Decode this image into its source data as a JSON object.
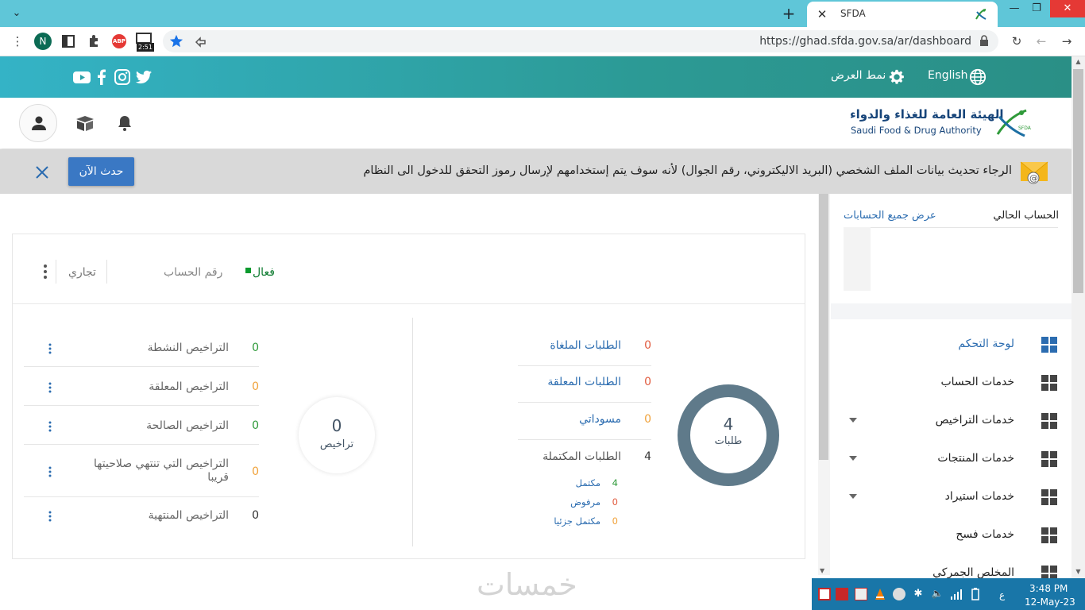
{
  "browser": {
    "tab_title": "SFDA",
    "url": "https://ghad.sfda.gov.sa/ar/dashboard",
    "profile_initial": "N",
    "extension_timer": "2:51",
    "abp_label": "ABP"
  },
  "site_header": {
    "language_label": "English",
    "theme_label": "نمط العرض",
    "social": [
      "youtube-icon",
      "facebook-icon",
      "instagram-icon",
      "twitter-icon"
    ],
    "logo_ar": "الهيئة العامة للغذاء والدواء",
    "logo_en": "Saudi Food & Drug Authority"
  },
  "alert": {
    "message": "الرجاء تحديث بيانات الملف الشخصي (البريد الاليكتروني، رقم الجوال) لأنه سوف يتم إستخدامهم لإرسال رموز التحقق للدخول الى النظام",
    "button_label": "حدث الآن"
  },
  "sidebar": {
    "current_account_label": "الحساب الحالي",
    "view_all_accounts_label": "عرض جميع الحسابات",
    "menu": [
      {
        "label": "لوحة التحكم",
        "active": true,
        "expandable": false
      },
      {
        "label": "خدمات الحساب",
        "active": false,
        "expandable": false
      },
      {
        "label": "خدمات التراخيص",
        "active": false,
        "expandable": true
      },
      {
        "label": "خدمات المنتجات",
        "active": false,
        "expandable": true
      },
      {
        "label": "خدمات استيراد",
        "active": false,
        "expandable": true
      },
      {
        "label": "خدمات فسح",
        "active": false,
        "expandable": false
      },
      {
        "label": "المخلص الجمركي",
        "active": false,
        "expandable": false
      }
    ]
  },
  "account_card": {
    "status_label": "فعال",
    "account_number_placeholder": "رقم الحساب",
    "account_type": "تجاري"
  },
  "requests": {
    "total": "4",
    "caption": "طلبات",
    "rows": [
      {
        "label": "الطلبات الملغاة",
        "value": "0",
        "color": "#e15b3f"
      },
      {
        "label": "الطلبات المعلقة",
        "value": "0",
        "color": "#e15b3f"
      },
      {
        "label": "مسوداتي",
        "value": "0",
        "color": "#f0a23a"
      },
      {
        "label": "الطلبات المكتملة",
        "value": "4",
        "color": "#333333"
      }
    ],
    "completed_breakdown": [
      {
        "label": "مكتمل",
        "value": "4",
        "color": "#2f9a3a"
      },
      {
        "label": "مرفوض",
        "value": "0",
        "color": "#e15b3f"
      },
      {
        "label": "مكتمل جزئيا",
        "value": "0",
        "color": "#f0a23a"
      }
    ]
  },
  "licenses": {
    "total": "0",
    "caption": "تراخيص",
    "rows": [
      {
        "label": "التراخيص النشطة",
        "value": "0",
        "color": "#2f9a3a"
      },
      {
        "label": "التراخيص المعلقة",
        "value": "0",
        "color": "#f0a23a"
      },
      {
        "label": "التراخيص الصالحة",
        "value": "0",
        "color": "#2f9a3a"
      },
      {
        "label": "التراخيص التي تنتهي صلاحيتها قريبا",
        "value": "0",
        "color": "#f0a23a"
      },
      {
        "label": "التراخيص المنتهية",
        "value": "0",
        "color": "#333333"
      }
    ]
  },
  "taskbar": {
    "time": "3:48 PM",
    "date": "12-May-23",
    "keyboard": "ع"
  },
  "watermark": "خمسات",
  "colors": {
    "accent": "#2b6cb0",
    "header_gradient_start": "#34b3c6",
    "header_gradient_end": "#2a8f86",
    "donut": "#5f7a8a",
    "button": "#3a78c4"
  }
}
